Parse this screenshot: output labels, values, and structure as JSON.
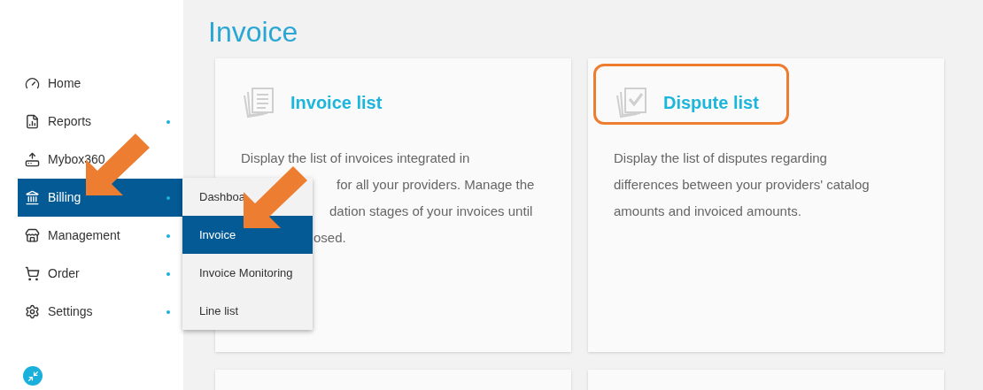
{
  "page_title": "Invoice",
  "sidebar": {
    "items": [
      {
        "label": "Home",
        "selected": false,
        "has_submenu": false
      },
      {
        "label": "Reports",
        "selected": false,
        "has_submenu": true
      },
      {
        "label": "Mybox360",
        "selected": false,
        "has_submenu": false
      },
      {
        "label": "Billing",
        "selected": true,
        "has_submenu": true
      },
      {
        "label": "Management",
        "selected": false,
        "has_submenu": true
      },
      {
        "label": "Order",
        "selected": false,
        "has_submenu": true
      },
      {
        "label": "Settings",
        "selected": false,
        "has_submenu": true
      }
    ]
  },
  "submenu": {
    "items": [
      {
        "label": "Dashboa",
        "selected": false
      },
      {
        "label": "Invoice",
        "selected": true
      },
      {
        "label": "Invoice Monitoring",
        "selected": false
      },
      {
        "label": "Line list",
        "selected": false
      }
    ]
  },
  "cards": [
    {
      "title": "Invoice list",
      "highlighted": false,
      "description_lines": [
        "Display the list of invoices integrated in",
        "for all your providers. Manage the",
        "dation stages of your invoices until",
        "osed."
      ]
    },
    {
      "title": "Dispute list",
      "highlighted": true,
      "description_lines": [
        "Display the list of disputes regarding",
        "differences between your providers' catalog",
        "amounts and invoiced amounts."
      ]
    }
  ]
}
